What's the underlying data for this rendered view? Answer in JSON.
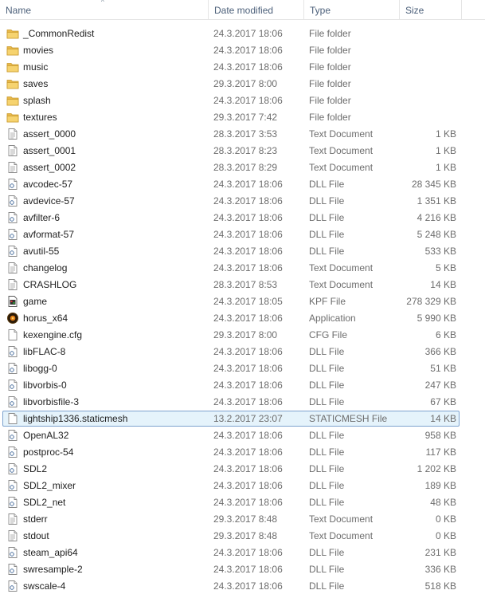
{
  "header": {
    "name_label": "Name",
    "date_label": "Date modified",
    "type_label": "Type",
    "size_label": "Size",
    "sort_indicator": "^"
  },
  "files": [
    {
      "name": "_CommonRedist",
      "date": "24.3.2017 18:06",
      "type": "File folder",
      "size": "",
      "icon": "folder-icon"
    },
    {
      "name": "movies",
      "date": "24.3.2017 18:06",
      "type": "File folder",
      "size": "",
      "icon": "folder-icon"
    },
    {
      "name": "music",
      "date": "24.3.2017 18:06",
      "type": "File folder",
      "size": "",
      "icon": "folder-icon"
    },
    {
      "name": "saves",
      "date": "29.3.2017 8:00",
      "type": "File folder",
      "size": "",
      "icon": "folder-icon"
    },
    {
      "name": "splash",
      "date": "24.3.2017 18:06",
      "type": "File folder",
      "size": "",
      "icon": "folder-icon"
    },
    {
      "name": "textures",
      "date": "29.3.2017 7:42",
      "type": "File folder",
      "size": "",
      "icon": "folder-icon"
    },
    {
      "name": "assert_0000",
      "date": "28.3.2017 3:53",
      "type": "Text Document",
      "size": "1 KB",
      "icon": "text-document-icon"
    },
    {
      "name": "assert_0001",
      "date": "28.3.2017 8:23",
      "type": "Text Document",
      "size": "1 KB",
      "icon": "text-document-icon"
    },
    {
      "name": "assert_0002",
      "date": "28.3.2017 8:29",
      "type": "Text Document",
      "size": "1 KB",
      "icon": "text-document-icon"
    },
    {
      "name": "avcodec-57",
      "date": "24.3.2017 18:06",
      "type": "DLL File",
      "size": "28 345 KB",
      "icon": "dll-file-icon"
    },
    {
      "name": "avdevice-57",
      "date": "24.3.2017 18:06",
      "type": "DLL File",
      "size": "1 351 KB",
      "icon": "dll-file-icon"
    },
    {
      "name": "avfilter-6",
      "date": "24.3.2017 18:06",
      "type": "DLL File",
      "size": "4 216 KB",
      "icon": "dll-file-icon"
    },
    {
      "name": "avformat-57",
      "date": "24.3.2017 18:06",
      "type": "DLL File",
      "size": "5 248 KB",
      "icon": "dll-file-icon"
    },
    {
      "name": "avutil-55",
      "date": "24.3.2017 18:06",
      "type": "DLL File",
      "size": "533 KB",
      "icon": "dll-file-icon"
    },
    {
      "name": "changelog",
      "date": "24.3.2017 18:06",
      "type": "Text Document",
      "size": "5 KB",
      "icon": "text-document-icon"
    },
    {
      "name": "CRASHLOG",
      "date": "28.3.2017 8:53",
      "type": "Text Document",
      "size": "14 KB",
      "icon": "text-document-icon"
    },
    {
      "name": "game",
      "date": "24.3.2017 18:05",
      "type": "KPF File",
      "size": "278 329 KB",
      "icon": "archive-file-icon"
    },
    {
      "name": "horus_x64",
      "date": "24.3.2017 18:06",
      "type": "Application",
      "size": "5 990 KB",
      "icon": "application-icon"
    },
    {
      "name": "kexengine.cfg",
      "date": "29.3.2017 8:00",
      "type": "CFG File",
      "size": "6 KB",
      "icon": "generic-file-icon"
    },
    {
      "name": "libFLAC-8",
      "date": "24.3.2017 18:06",
      "type": "DLL File",
      "size": "366 KB",
      "icon": "dll-file-icon"
    },
    {
      "name": "libogg-0",
      "date": "24.3.2017 18:06",
      "type": "DLL File",
      "size": "51 KB",
      "icon": "dll-file-icon"
    },
    {
      "name": "libvorbis-0",
      "date": "24.3.2017 18:06",
      "type": "DLL File",
      "size": "247 KB",
      "icon": "dll-file-icon"
    },
    {
      "name": "libvorbisfile-3",
      "date": "24.3.2017 18:06",
      "type": "DLL File",
      "size": "67 KB",
      "icon": "dll-file-icon"
    },
    {
      "name": "lightship1336.staticmesh",
      "date": "13.2.2017 23:07",
      "type": "STATICMESH File",
      "size": "14 KB",
      "icon": "generic-file-icon",
      "selected": true
    },
    {
      "name": "OpenAL32",
      "date": "24.3.2017 18:06",
      "type": "DLL File",
      "size": "958 KB",
      "icon": "dll-file-icon"
    },
    {
      "name": "postproc-54",
      "date": "24.3.2017 18:06",
      "type": "DLL File",
      "size": "117 KB",
      "icon": "dll-file-icon"
    },
    {
      "name": "SDL2",
      "date": "24.3.2017 18:06",
      "type": "DLL File",
      "size": "1 202 KB",
      "icon": "dll-file-icon"
    },
    {
      "name": "SDL2_mixer",
      "date": "24.3.2017 18:06",
      "type": "DLL File",
      "size": "189 KB",
      "icon": "dll-file-icon"
    },
    {
      "name": "SDL2_net",
      "date": "24.3.2017 18:06",
      "type": "DLL File",
      "size": "48 KB",
      "icon": "dll-file-icon"
    },
    {
      "name": "stderr",
      "date": "29.3.2017 8:48",
      "type": "Text Document",
      "size": "0 KB",
      "icon": "text-document-icon"
    },
    {
      "name": "stdout",
      "date": "29.3.2017 8:48",
      "type": "Text Document",
      "size": "0 KB",
      "icon": "text-document-icon"
    },
    {
      "name": "steam_api64",
      "date": "24.3.2017 18:06",
      "type": "DLL File",
      "size": "231 KB",
      "icon": "dll-file-icon"
    },
    {
      "name": "swresample-2",
      "date": "24.3.2017 18:06",
      "type": "DLL File",
      "size": "336 KB",
      "icon": "dll-file-icon"
    },
    {
      "name": "swscale-4",
      "date": "24.3.2017 18:06",
      "type": "DLL File",
      "size": "518 KB",
      "icon": "dll-file-icon"
    }
  ]
}
